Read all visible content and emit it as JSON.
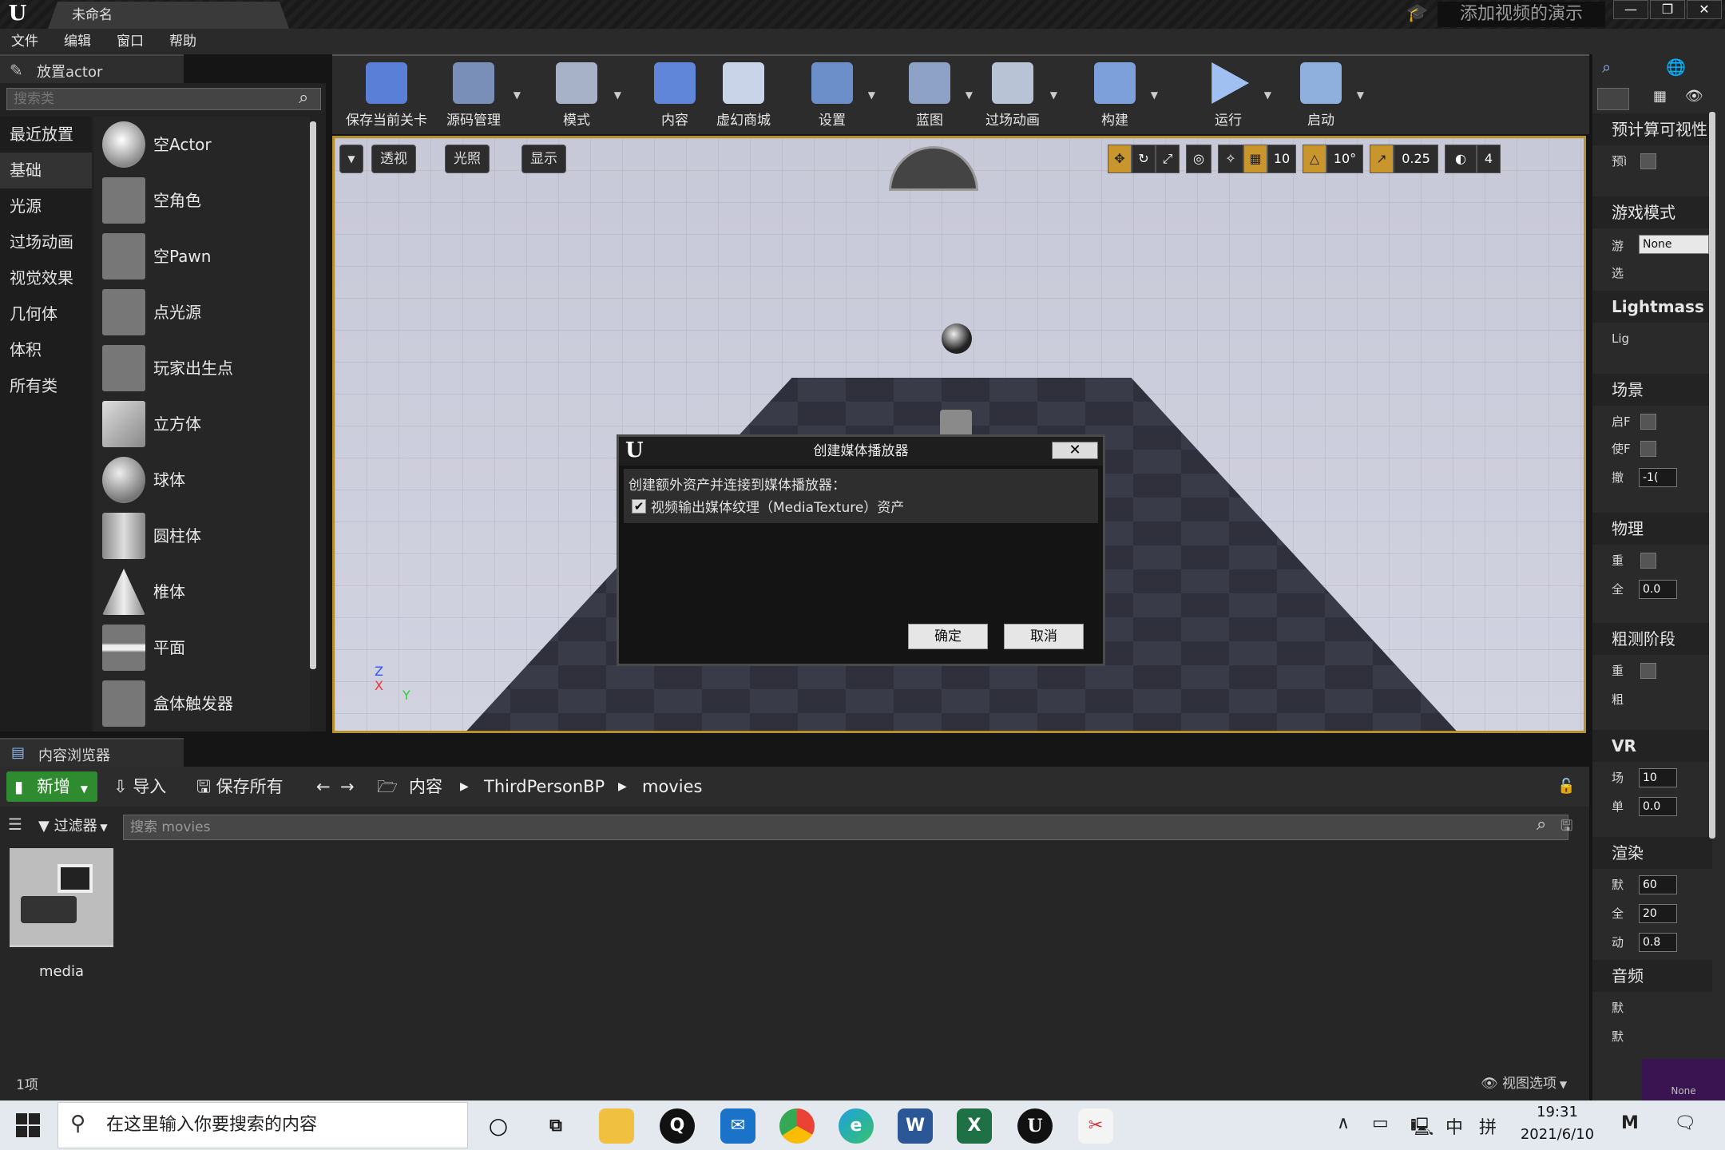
{
  "window": {
    "tab_title": "未命名",
    "promo_text": "添加视频的演示",
    "controls": [
      "—",
      "❐",
      "✕"
    ]
  },
  "menu": [
    "文件",
    "编辑",
    "窗口",
    "帮助"
  ],
  "place_actor": {
    "tab_label": "放置actor",
    "search_placeholder": "搜索类",
    "categories": [
      "最近放置",
      "基础",
      "光源",
      "过场动画",
      "视觉效果",
      "几何体",
      "体积",
      "所有类"
    ],
    "selected_category": "基础",
    "actors": [
      "空Actor",
      "空角色",
      "空Pawn",
      "点光源",
      "玩家出生点",
      "立方体",
      "球体",
      "圆柱体",
      "椎体",
      "平面",
      "盒体触发器"
    ]
  },
  "toolbar": {
    "items": [
      {
        "label": "保存当前关卡",
        "icon": "save-icon",
        "color": "#5a7fd6"
      },
      {
        "label": "源码管理",
        "icon": "source-control-icon",
        "color": "#7a8fb8"
      },
      {
        "label": "模式",
        "icon": "modes-icon",
        "color": "#a7b2c8"
      },
      {
        "label": "内容",
        "icon": "content-icon",
        "color": "#5f86d8"
      },
      {
        "label": "虚幻商城",
        "icon": "marketplace-icon",
        "color": "#c9d4e8"
      },
      {
        "label": "设置",
        "icon": "settings-icon",
        "color": "#6d8fc9"
      },
      {
        "label": "蓝图",
        "icon": "blueprint-icon",
        "color": "#8da2c6"
      },
      {
        "label": "过场动画",
        "icon": "cinematics-icon",
        "color": "#b9c3d6"
      },
      {
        "label": "构建",
        "icon": "build-icon",
        "color": "#7ea0da"
      },
      {
        "label": "运行",
        "icon": "play-icon",
        "color": "#9fc0f0"
      },
      {
        "label": "启动",
        "icon": "launch-icon",
        "color": "#8fb0dc"
      }
    ]
  },
  "viewport": {
    "perspective": "透视",
    "lighting": "光照",
    "show": "显示",
    "grid_snap": "10",
    "rotate_snap": "10°",
    "scale_snap": "0.25",
    "camera_speed": "4",
    "axes": {
      "z": "Z",
      "x": "X",
      "y": "Y"
    }
  },
  "dialog": {
    "title": "创建媒体播放器",
    "prompt": "创建额外资产并连接到媒体播放器：",
    "checkbox_label": "视频输出媒体纹理（MediaTexture）资产",
    "checkbox_checked": true,
    "ok": "确定",
    "cancel": "取消"
  },
  "content_browser": {
    "tab_label": "内容浏览器",
    "new_label": "新增",
    "import_label": "导入",
    "save_all_label": "保存所有",
    "breadcrumbs": [
      "内容",
      "ThirdPersonBP",
      "movies"
    ],
    "filters_label": "过滤器",
    "search_placeholder": "搜索 movies",
    "assets": [
      {
        "name": "media"
      }
    ],
    "item_count": "1项",
    "view_options": "视图选项"
  },
  "details": {
    "sections": [
      {
        "title": "预计算可视性",
        "rows": [
          "预ì"
        ]
      },
      {
        "title": "游戏模式",
        "rows": [
          "游",
          "选"
        ],
        "game_mode_value": "None"
      },
      {
        "title": "Lightmass",
        "rows": [
          "Lig"
        ]
      },
      {
        "title": "场景",
        "rows": [
          "启F",
          "使F",
          "撤"
        ],
        "value": "-1("
      },
      {
        "title": "物理",
        "rows": [
          "重",
          "全"
        ],
        "value": "0.0"
      },
      {
        "title": "粗测阶段",
        "rows": [
          "重",
          "粗"
        ]
      },
      {
        "title": "VR",
        "rows": [
          "场",
          "单"
        ],
        "values": [
          "10",
          "0.0"
        ]
      },
      {
        "title": "渲染",
        "rows": [
          "默",
          "全",
          "动"
        ],
        "values": [
          "60",
          "20",
          "0.8"
        ]
      },
      {
        "title": "音频",
        "rows": [
          "默",
          "默"
        ]
      }
    ],
    "bottom_swatch": "None"
  },
  "taskbar": {
    "search_placeholder": "在这里输入你要搜索的内容",
    "time": "19:31",
    "date": "2021/6/10",
    "ime": "中",
    "ime2": "拼"
  }
}
